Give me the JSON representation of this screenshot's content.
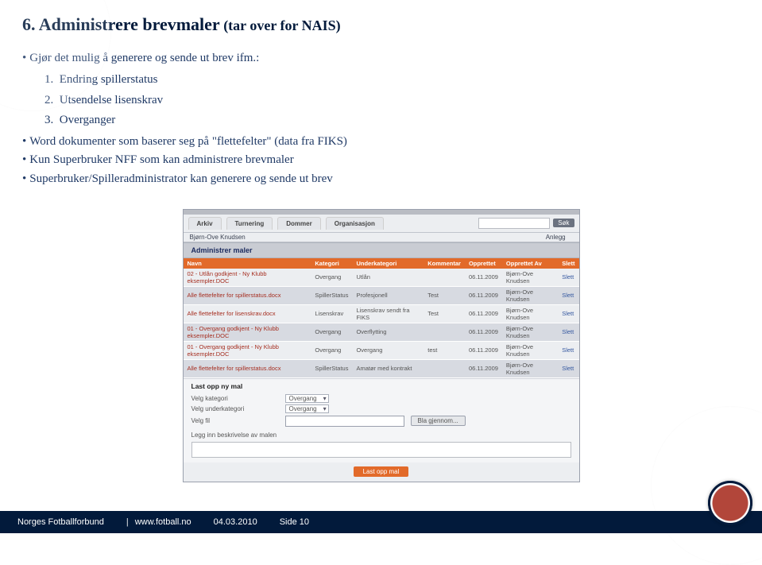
{
  "title_strong": "6. Administrere brevmaler",
  "title_small": " (tar over for NAIS)",
  "bullets": {
    "b1": "Gjør det mulig å generere og sende ut brev ifm.:",
    "n1": "Endring spillerstatus",
    "n2": "Utsendelse lisenskrav",
    "n3": "Overganger",
    "b2": "Word dokumenter som baserer seg på \"flettefelter\" (data fra FIKS)",
    "b3": "Kun Superbruker NFF som kan administrere brevmaler",
    "b4": "Superbruker/Spilleradministrator kan generere og sende ut brev"
  },
  "app": {
    "tabs": {
      "t1": "Arkiv",
      "t2": "Turnering",
      "t3": "Dommer",
      "t4": "Organisasjon"
    },
    "search_btn": "Søk",
    "anlegg": "Anlegg",
    "user": "Bjørn-Ove Knudsen",
    "section1": "Administrer maler",
    "cols": {
      "navn": "Navn",
      "kat": "Kategori",
      "ukat": "Underkategori",
      "komm": "Kommentar",
      "opp": "Opprettet",
      "av": "Opprettet Av",
      "slett": "Slett"
    },
    "rows": [
      {
        "navn": "02 - Utlån godkjent - Ny Klubb eksempler.DOC",
        "kat": "Overgang",
        "ukat": "Utlån",
        "komm": "",
        "opp": "06.11.2009",
        "av": "Bjørn-Ove Knudsen",
        "slett": "Slett"
      },
      {
        "navn": "Alle flettefelter for spillerstatus.docx",
        "kat": "SpillerStatus",
        "ukat": "Profesjonell",
        "komm": "Test",
        "opp": "06.11.2009",
        "av": "Bjørn-Ove Knudsen",
        "slett": "Slett"
      },
      {
        "navn": "Alle flettefelter for lisenskrav.docx",
        "kat": "Lisenskrav",
        "ukat": "Lisenskrav sendt fra FIKS",
        "komm": "Test",
        "opp": "06.11.2009",
        "av": "Bjørn-Ove Knudsen",
        "slett": "Slett"
      },
      {
        "navn": "01 - Overgang godkjent - Ny Klubb eksempler.DOC",
        "kat": "Overgang",
        "ukat": "Overflytting",
        "komm": "",
        "opp": "06.11.2009",
        "av": "Bjørn-Ove Knudsen",
        "slett": "Slett"
      },
      {
        "navn": "01 - Overgang godkjent - Ny Klubb eksempler.DOC",
        "kat": "Overgang",
        "ukat": "Overgang",
        "komm": "test",
        "opp": "06.11.2009",
        "av": "Bjørn-Ove Knudsen",
        "slett": "Slett"
      },
      {
        "navn": "Alle flettefelter for spillerstatus.docx",
        "kat": "SpillerStatus",
        "ukat": "Amatør med kontrakt",
        "komm": "",
        "opp": "06.11.2009",
        "av": "Bjørn-Ove Knudsen",
        "slett": "Slett"
      }
    ],
    "upload_title": "Last opp ny mal",
    "form": {
      "l1": "Velg kategori",
      "v1": "Overgang",
      "l2": "Velg underkategori",
      "v2": "Overgang",
      "l3": "Velg fil",
      "file_btn": "Bla gjennom...",
      "l4": "Legg inn beskrivelse av malen"
    },
    "action_btn": "Last opp mal"
  },
  "footer": {
    "org": "Norges Fotballforbund",
    "url": "www.fotball.no",
    "date": "04.03.2010",
    "page": "Side 10"
  }
}
